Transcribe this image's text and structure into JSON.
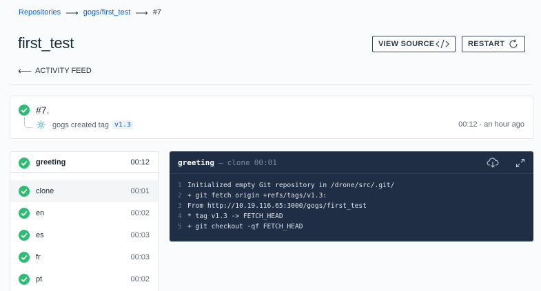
{
  "breadcrumb": {
    "repositories": "Repositories",
    "repo": "gogs/first_test",
    "build": "#7",
    "separator": "⟶"
  },
  "page": {
    "title": "first_test",
    "view_source_label": "VIEW SOURCE",
    "restart_label": "RESTART",
    "activity_feed_label": "ACTIVITY FEED"
  },
  "build": {
    "number": "#7.",
    "event_text": "gogs created tag",
    "tag": "v1.3",
    "duration": "00:12",
    "separator": "·",
    "relative_time": "an hour ago",
    "status": "success"
  },
  "stage": {
    "name": "greeting",
    "duration": "00:12"
  },
  "steps": [
    {
      "name": "clone",
      "duration": "00:01",
      "active": true
    },
    {
      "name": "en",
      "duration": "00:02",
      "active": false
    },
    {
      "name": "es",
      "duration": "00:03",
      "active": false
    },
    {
      "name": "fr",
      "duration": "00:03",
      "active": false
    },
    {
      "name": "pt",
      "duration": "00:02",
      "active": false
    }
  ],
  "console": {
    "stage": "greeting",
    "dash": "—",
    "step": "clone",
    "duration": "00:01",
    "download_icon": "cloud-download-icon",
    "expand_icon": "expand-icon",
    "lines": [
      {
        "n": "1",
        "text": "Initialized empty Git repository in /drone/src/.git/"
      },
      {
        "n": "2",
        "text": "+ git fetch origin +refs/tags/v1.3:"
      },
      {
        "n": "3",
        "text": "From http://10.19.116.65:3000/gogs/first_test"
      },
      {
        "n": "4",
        "text": "* tag v1.3 -> FETCH_HEAD"
      },
      {
        "n": "5",
        "text": "+ git checkout -qf FETCH_HEAD"
      }
    ]
  },
  "colors": {
    "success": "#2dbd72",
    "link": "#0564d7",
    "console_bg": "#1f2d45"
  }
}
